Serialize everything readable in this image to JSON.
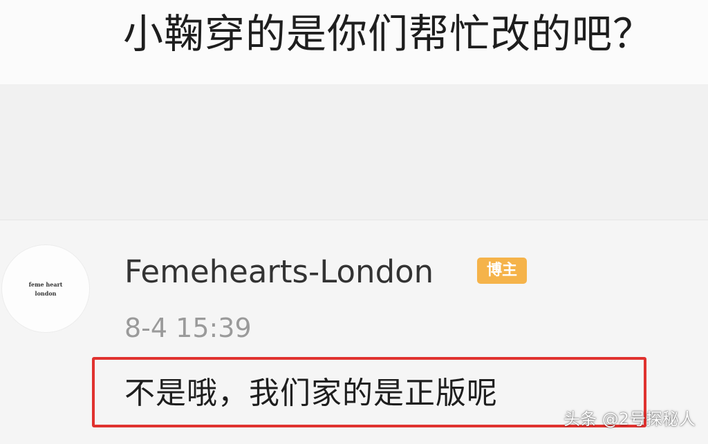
{
  "question": {
    "text": "小鞠穿的是你们帮忙改的吧？"
  },
  "comment": {
    "avatar": {
      "line1": "feme heart",
      "line2": "london"
    },
    "username": "Femehearts-London",
    "badge_label": "博主",
    "timestamp": "8-4 15:39",
    "reply_text": "不是哦，我们家的是正版呢",
    "highlight_color": "#e0322f"
  },
  "watermark": {
    "text": "头条 @2号探秘人"
  },
  "colors": {
    "badge": "#f5b34a",
    "text_primary": "#1e1e1e",
    "text_secondary": "#9a9a9a"
  }
}
